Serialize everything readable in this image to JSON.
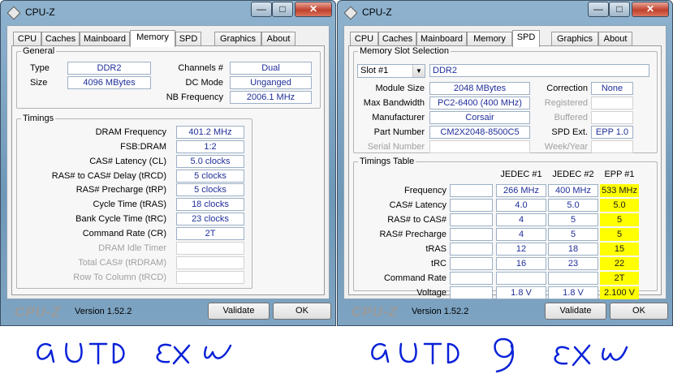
{
  "left": {
    "title": "CPU-Z",
    "tabs": [
      "CPU",
      "Caches",
      "Mainboard",
      "Memory",
      "SPD",
      "Graphics",
      "About"
    ],
    "active_tab": "Memory",
    "general": {
      "legend": "General",
      "type_label": "Type",
      "type_value": "DDR2",
      "size_label": "Size",
      "size_value": "4096 MBytes",
      "channels_label": "Channels #",
      "channels_value": "Dual",
      "dcmode_label": "DC Mode",
      "dcmode_value": "Unganged",
      "nbfreq_label": "NB Frequency",
      "nbfreq_value": "2006.1 MHz"
    },
    "timings": {
      "legend": "Timings",
      "rows": [
        {
          "label": "DRAM Frequency",
          "value": "401.2 MHz"
        },
        {
          "label": "FSB:DRAM",
          "value": "1:2"
        },
        {
          "label": "CAS# Latency (CL)",
          "value": "5.0 clocks"
        },
        {
          "label": "RAS# to CAS# Delay (tRCD)",
          "value": "5 clocks"
        },
        {
          "label": "RAS# Precharge (tRP)",
          "value": "5 clocks"
        },
        {
          "label": "Cycle Time (tRAS)",
          "value": "18 clocks"
        },
        {
          "label": "Bank Cycle Time (tRC)",
          "value": "23 clocks"
        },
        {
          "label": "Command Rate (CR)",
          "value": "2T"
        },
        {
          "label": "DRAM Idle Timer",
          "value": ""
        },
        {
          "label": "Total CAS# (tRDRAM)",
          "value": ""
        },
        {
          "label": "Row To Column (tRCD)",
          "value": ""
        }
      ]
    },
    "footer": {
      "brand": "CPU-Z",
      "version": "Version 1.52.2",
      "validate": "Validate",
      "ok": "OK"
    }
  },
  "right": {
    "title": "CPU-Z",
    "tabs": [
      "CPU",
      "Caches",
      "Mainboard",
      "Memory",
      "SPD",
      "Graphics",
      "About"
    ],
    "active_tab": "SPD",
    "slot": {
      "legend": "Memory Slot Selection",
      "selected": "Slot #1",
      "type_value": "DDR2",
      "module_size_label": "Module Size",
      "module_size_value": "2048 MBytes",
      "max_bw_label": "Max Bandwidth",
      "max_bw_value": "PC2-6400 (400 MHz)",
      "manufacturer_label": "Manufacturer",
      "manufacturer_value": "Corsair",
      "part_label": "Part Number",
      "part_value": "CM2X2048-8500C5",
      "serial_label": "Serial Number",
      "serial_value": "",
      "correction_label": "Correction",
      "correction_value": "None",
      "registered_label": "Registered",
      "buffered_label": "Buffered",
      "spdext_label": "SPD Ext.",
      "spdext_value": "EPP 1.0",
      "weekyear_label": "Week/Year"
    },
    "timings_table": {
      "legend": "Timings Table",
      "columns": [
        "JEDEC #1",
        "JEDEC #2",
        "EPP #1"
      ],
      "rows": [
        {
          "label": "Frequency",
          "values": [
            "266 MHz",
            "400 MHz",
            "533 MHz"
          ]
        },
        {
          "label": "CAS# Latency",
          "values": [
            "4.0",
            "5.0",
            "5.0"
          ]
        },
        {
          "label": "RAS# to CAS#",
          "values": [
            "4",
            "5",
            "5"
          ]
        },
        {
          "label": "RAS# Precharge",
          "values": [
            "4",
            "5",
            "5"
          ]
        },
        {
          "label": "tRAS",
          "values": [
            "12",
            "18",
            "15"
          ]
        },
        {
          "label": "tRC",
          "values": [
            "16",
            "23",
            "22"
          ]
        },
        {
          "label": "Command Rate",
          "values": [
            "",
            "",
            "2T"
          ]
        },
        {
          "label": "Voltage",
          "values": [
            "1.8 V",
            "1.8 V",
            "2.100 V"
          ]
        }
      ]
    },
    "footer": {
      "brand": "CPU-Z",
      "version": "Version 1.52.2",
      "validate": "Validate",
      "ok": "OK"
    }
  },
  "handwriting": {
    "left_note": "AUTO EXW",
    "right_note": "AUTO 9 EXW"
  },
  "colors": {
    "highlight": "#ffff00",
    "value_text": "#1f2e9a",
    "ink_blue": "#0a22d8"
  }
}
